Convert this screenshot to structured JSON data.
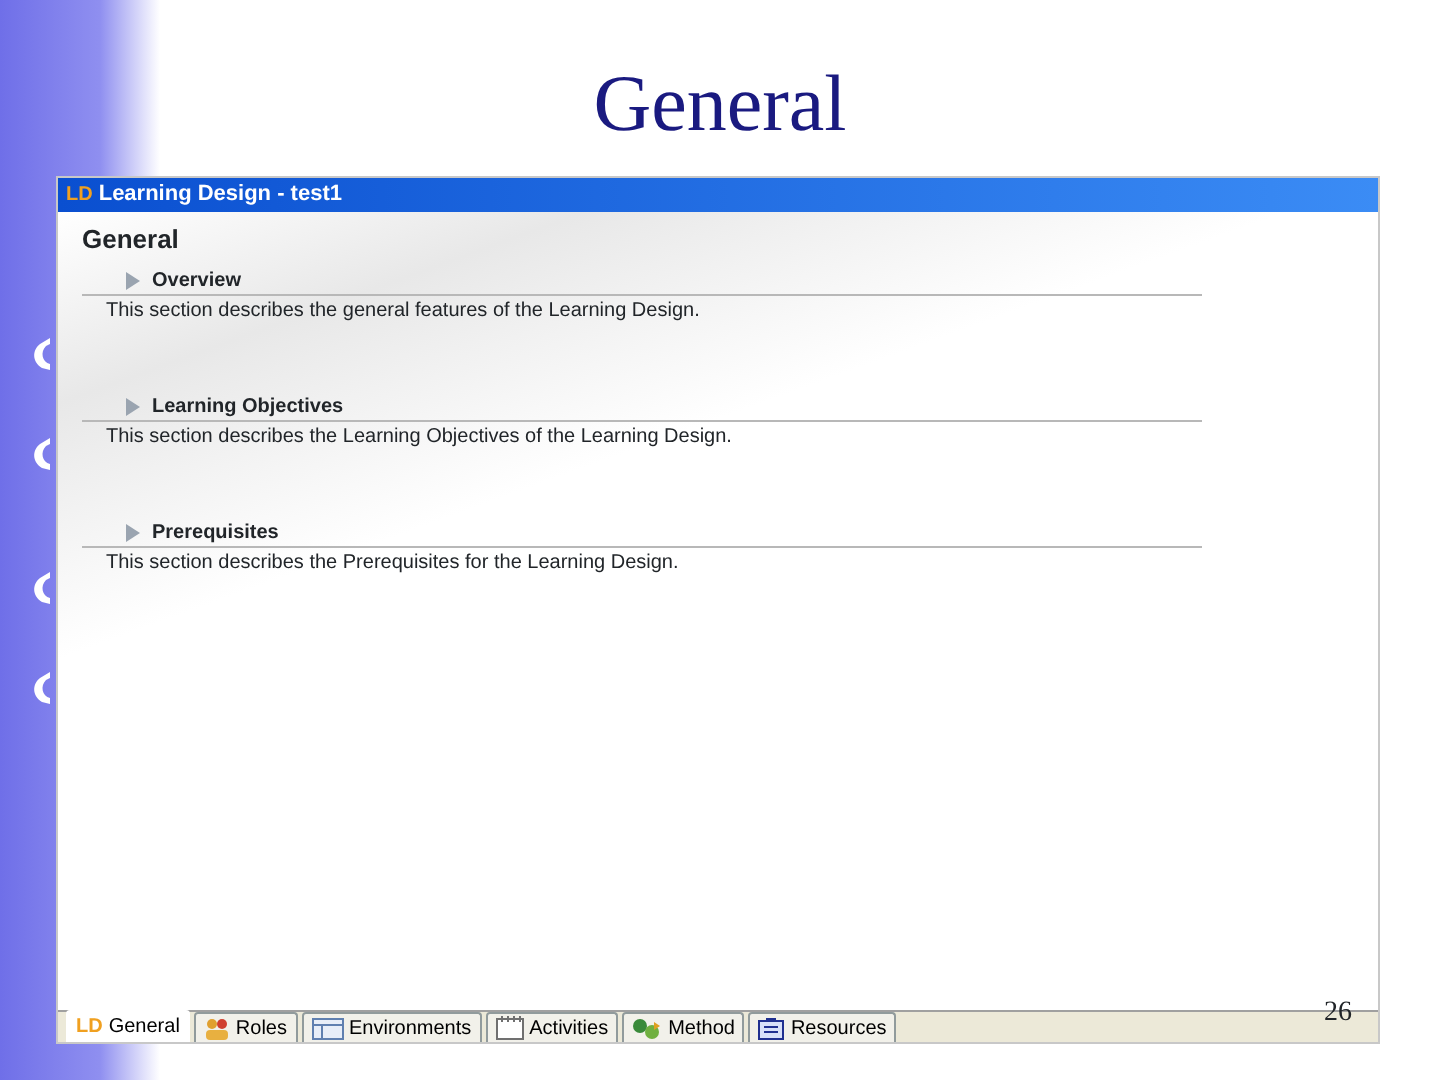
{
  "slide": {
    "title": "General",
    "page_number": "26"
  },
  "window": {
    "badge": "LD",
    "title": "Learning Design - test1"
  },
  "page_heading": "General",
  "sections": [
    {
      "title": "Overview",
      "description": "This section describes the general features of the Learning Design."
    },
    {
      "title": "Learning Objectives",
      "description": "This section describes the Learning Objectives of the Learning Design."
    },
    {
      "title": "Prerequisites",
      "description": "This section describes the Prerequisites for the Learning Design."
    }
  ],
  "tabs": [
    {
      "label": "General",
      "kind": "ld",
      "badge": "LD",
      "selected": true
    },
    {
      "label": "Roles",
      "kind": "roles",
      "selected": false
    },
    {
      "label": "Environments",
      "kind": "environments",
      "selected": false
    },
    {
      "label": "Activities",
      "kind": "activities",
      "selected": false
    },
    {
      "label": "Method",
      "kind": "method",
      "selected": false
    },
    {
      "label": "Resources",
      "kind": "resources",
      "selected": false
    }
  ]
}
